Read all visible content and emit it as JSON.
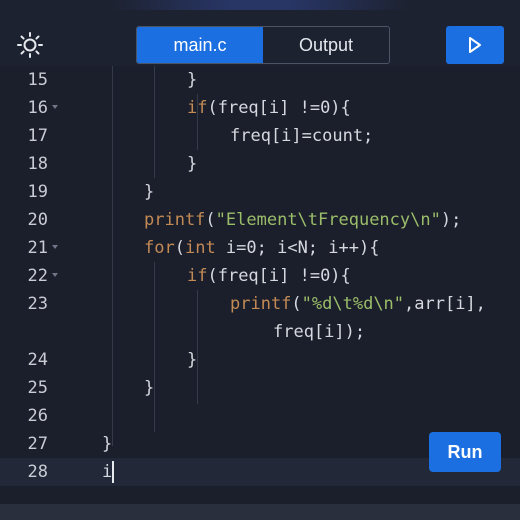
{
  "header": {
    "theme_icon": "sun-icon",
    "tabs": [
      {
        "label": "main.c",
        "active": true
      },
      {
        "label": "Output",
        "active": false
      }
    ],
    "run_icon": "play-icon"
  },
  "colors": {
    "accent": "#1b6fe0",
    "keyword": "#c38a55",
    "string": "#9bbd6a",
    "text": "#d5d8de",
    "background": "#1b1f2b"
  },
  "editor": {
    "lines": [
      {
        "num": "15",
        "fold": false,
        "code": "}"
      },
      {
        "num": "16",
        "fold": true,
        "code": "if(freq[i] !=0){"
      },
      {
        "num": "17",
        "fold": false,
        "code": "freq[i]=count;"
      },
      {
        "num": "18",
        "fold": false,
        "code": "}"
      },
      {
        "num": "19",
        "fold": false,
        "code": "}"
      },
      {
        "num": "20",
        "fold": false,
        "code": "printf(\"Element\\tFrequency\\n\");"
      },
      {
        "num": "21",
        "fold": true,
        "code": "for(int i=0; i<N; i++){"
      },
      {
        "num": "22",
        "fold": true,
        "code": "if(freq[i] !=0){"
      },
      {
        "num": "23",
        "fold": false,
        "code": "printf(\"%d\\t%d\\n\",arr[i],"
      },
      {
        "num": "",
        "fold": false,
        "code": "freq[i]);"
      },
      {
        "num": "24",
        "fold": false,
        "code": "}"
      },
      {
        "num": "25",
        "fold": false,
        "code": "}"
      },
      {
        "num": "26",
        "fold": false,
        "code": ""
      },
      {
        "num": "27",
        "fold": false,
        "code": "}"
      },
      {
        "num": "28",
        "fold": false,
        "code": "i"
      }
    ]
  },
  "run_button": {
    "label": "Run"
  }
}
